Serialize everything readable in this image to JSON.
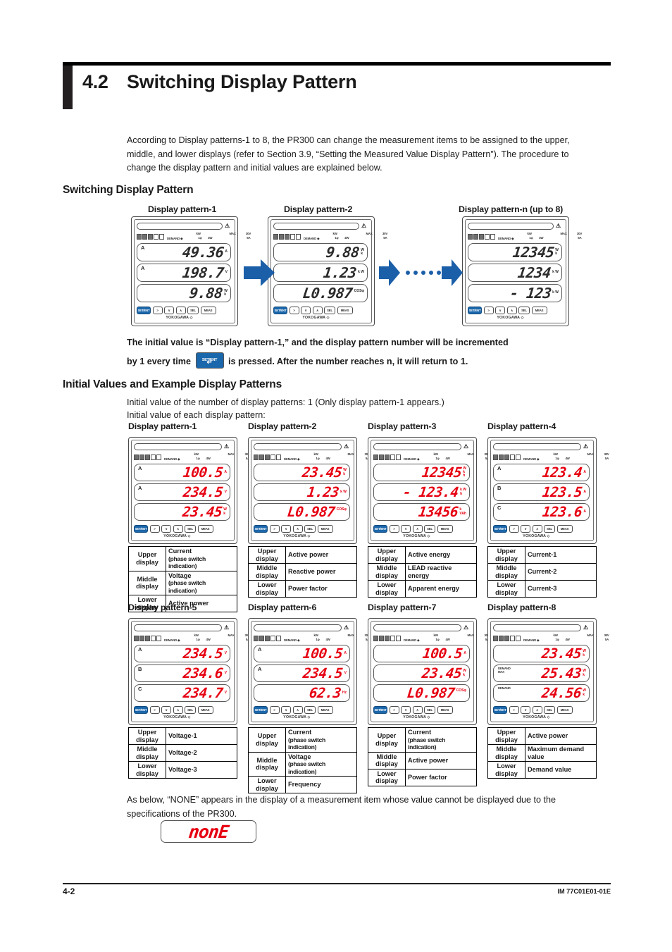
{
  "section": {
    "number": "4.2",
    "title": "Switching Display Pattern",
    "intro": "According to Display patterns-1 to 8, the PR300 can change the measurement items to be assigned to the upper, middle, and lower displays (refer to Section 3.9, “Setting the Measured Value Display Pattern”). The procedure to change the display pattern and initial values are explained below."
  },
  "switching": {
    "heading": "Switching Display Pattern",
    "labels": {
      "p1": "Display pattern-1",
      "p2": "Display pattern-2",
      "pn": "Display pattern-n (up to 8)"
    },
    "note_part1": "The initial value is “Display pattern-1,” and the display pattern number will be incremented",
    "note_part2": "by 1 every time",
    "note_part3": "is pressed. After the number reaches n, it will return to 1.",
    "setent_key": "SET/ENT"
  },
  "initial": {
    "heading": "Initial Values and Example Display Patterns",
    "line1": "Initial value of the number of display patterns: 1  (Only display pattern-1 appears.)",
    "line2": "Initial value of each display pattern:"
  },
  "meter": {
    "brand": "PR300",
    "logo": "YOKOGAWA ◇",
    "warn_icon": "warning-triangle-icon",
    "top_labels": [
      "kW",
      "1φ",
      "4W",
      "MAX",
      "30V",
      "5A"
    ],
    "buttons": [
      "SET/ENT",
      ">",
      "∨",
      "∧",
      "SEL",
      "MEAS"
    ]
  },
  "flow_meters": [
    {
      "id": "flow-1",
      "rows": [
        {
          "phase": "A",
          "value": "49.36",
          "unit_top": "",
          "unit_mid": "A",
          "unit_bot": ""
        },
        {
          "phase": "A",
          "value": "198.7",
          "unit_top": "",
          "unit_mid": "V",
          "unit_bot": ""
        },
        {
          "phase": "",
          "value": "9.88",
          "unit_top": "W",
          "unit_mid": "k",
          "unit_bot": ""
        }
      ]
    },
    {
      "id": "flow-2",
      "rows": [
        {
          "phase": "",
          "value": "9.88",
          "unit_top": "W",
          "unit_mid": "k",
          "unit_bot": ""
        },
        {
          "phase": "",
          "value": "1.23",
          "unit_top": "",
          "unit_mid": "k W",
          "unit_bot": ""
        },
        {
          "phase": "",
          "value": "L0.987",
          "unit_top": "COSφ",
          "unit_mid": "",
          "unit_bot": ""
        }
      ]
    },
    {
      "id": "flow-n",
      "rows": [
        {
          "phase": "",
          "value": "12345",
          "unit_top": "W",
          "unit_mid": "k",
          "unit_bot": ""
        },
        {
          "phase": "",
          "value": "1234",
          "unit_top": "",
          "unit_mid": "k W",
          "unit_bot": ""
        },
        {
          "phase": "",
          "value": "- 123",
          "unit_top": "",
          "unit_mid": "k W",
          "unit_bot": ""
        }
      ]
    }
  ],
  "patterns": [
    {
      "label": "Display pattern-1",
      "rows": [
        {
          "phase": "A",
          "demand": "",
          "value": "100.5",
          "unit_top": "",
          "unit_mid": "A",
          "unit_bot": ""
        },
        {
          "phase": "A",
          "demand": "",
          "value": "234.5",
          "unit_top": "",
          "unit_mid": "V",
          "unit_bot": ""
        },
        {
          "phase": "",
          "demand": "",
          "value": "23.45",
          "unit_top": "W",
          "unit_mid": "k",
          "unit_bot": ""
        }
      ],
      "table": [
        {
          "key": "Upper display",
          "value": "Current",
          "sub": "(phase switch indication)"
        },
        {
          "key": "Middle display",
          "value": "Voltage",
          "sub": "(phase switch indication)"
        },
        {
          "key": "Lower display",
          "value": "Active power",
          "sub": ""
        }
      ]
    },
    {
      "label": "Display pattern-2",
      "rows": [
        {
          "phase": "",
          "demand": "",
          "value": "23.45",
          "unit_top": "W",
          "unit_mid": "k",
          "unit_bot": ""
        },
        {
          "phase": "",
          "demand": "",
          "value": "1.23",
          "unit_top": "",
          "unit_mid": "k W",
          "unit_bot": ""
        },
        {
          "phase": "",
          "demand": "",
          "value": "L0.987",
          "unit_top": "COSφ",
          "unit_mid": "",
          "unit_bot": ""
        }
      ],
      "table": [
        {
          "key": "Upper display",
          "value": "Active power",
          "sub": ""
        },
        {
          "key": "Middle display",
          "value": "Reactive power",
          "sub": ""
        },
        {
          "key": "Lower display",
          "value": "Power factor",
          "sub": ""
        }
      ]
    },
    {
      "label": "Display pattern-3",
      "rows": [
        {
          "phase": "",
          "demand": "",
          "value": "12345",
          "unit_top": "W",
          "unit_mid": "k",
          "unit_bot": "h"
        },
        {
          "phase": "",
          "demand": "",
          "value": "- 123.4",
          "unit_top": "",
          "unit_mid": "k W",
          "unit_bot": "h"
        },
        {
          "phase": "",
          "demand": "",
          "value": "13456",
          "unit_top": "",
          "unit_mid": "k",
          "unit_bot": "VAh"
        }
      ],
      "table": [
        {
          "key": "Upper display",
          "value": "Active energy",
          "sub": ""
        },
        {
          "key": "Middle display",
          "value": "LEAD reactive energy",
          "sub": ""
        },
        {
          "key": "Lower display",
          "value": "Apparent energy",
          "sub": ""
        }
      ]
    },
    {
      "label": "Display pattern-4",
      "rows": [
        {
          "phase": "A",
          "demand": "",
          "value": "123.4",
          "unit_top": "",
          "unit_mid": "A",
          "unit_bot": ""
        },
        {
          "phase": "B",
          "demand": "",
          "value": "123.5",
          "unit_top": "",
          "unit_mid": "A",
          "unit_bot": ""
        },
        {
          "phase": "C",
          "demand": "",
          "value": "123.6",
          "unit_top": "",
          "unit_mid": "A",
          "unit_bot": ""
        }
      ],
      "table": [
        {
          "key": "Upper display",
          "value": "Current-1",
          "sub": ""
        },
        {
          "key": "Middle display",
          "value": "Current-2",
          "sub": ""
        },
        {
          "key": "Lower display",
          "value": "Current-3",
          "sub": ""
        }
      ]
    },
    {
      "label": "Display pattern-5",
      "rows": [
        {
          "phase": "A",
          "demand": "",
          "value": "234.5",
          "unit_top": "",
          "unit_mid": "V",
          "unit_bot": ""
        },
        {
          "phase": "B",
          "demand": "",
          "value": "234.6",
          "unit_top": "",
          "unit_mid": "V",
          "unit_bot": ""
        },
        {
          "phase": "C",
          "demand": "",
          "value": "234.7",
          "unit_top": "",
          "unit_mid": "V",
          "unit_bot": ""
        }
      ],
      "table": [
        {
          "key": "Upper display",
          "value": "Voltage-1",
          "sub": ""
        },
        {
          "key": "Middle display",
          "value": "Voltage-2",
          "sub": ""
        },
        {
          "key": "Lower display",
          "value": "Voltage-3",
          "sub": ""
        }
      ]
    },
    {
      "label": "Display pattern-6",
      "rows": [
        {
          "phase": "A",
          "demand": "",
          "value": "100.5",
          "unit_top": "",
          "unit_mid": "A",
          "unit_bot": ""
        },
        {
          "phase": "A",
          "demand": "",
          "value": "234.5",
          "unit_top": "",
          "unit_mid": "V",
          "unit_bot": ""
        },
        {
          "phase": "",
          "demand": "",
          "value": "62.3",
          "unit_top": "",
          "unit_mid": "Hz",
          "unit_bot": ""
        }
      ],
      "table": [
        {
          "key": "Upper display",
          "value": "Current",
          "sub": "(phase switch indication)"
        },
        {
          "key": "Middle display",
          "value": "Voltage",
          "sub": "(phase switch indication)"
        },
        {
          "key": "Lower display",
          "value": "Frequency",
          "sub": ""
        }
      ]
    },
    {
      "label": "Display pattern-7",
      "rows": [
        {
          "phase": "",
          "demand": "",
          "value": "100.5",
          "unit_top": "",
          "unit_mid": "A",
          "unit_bot": ""
        },
        {
          "phase": "",
          "demand": "",
          "value": "23.45",
          "unit_top": "W",
          "unit_mid": "k",
          "unit_bot": ""
        },
        {
          "phase": "",
          "demand": "",
          "value": "L0.987",
          "unit_top": "COSφ",
          "unit_mid": "",
          "unit_bot": ""
        }
      ],
      "table": [
        {
          "key": "Upper display",
          "value": "Current",
          "sub": "(phase switch indication)"
        },
        {
          "key": "Middle display",
          "value": "Active power",
          "sub": ""
        },
        {
          "key": "Lower display",
          "value": "Power factor",
          "sub": ""
        }
      ]
    },
    {
      "label": "Display pattern-8",
      "rows": [
        {
          "phase": "",
          "demand": "",
          "value": "23.45",
          "unit_top": "W",
          "unit_mid": "k",
          "unit_bot": ""
        },
        {
          "phase": "",
          "demand": "DEMAND\nMAX",
          "value": "25.43",
          "unit_top": "W",
          "unit_mid": "k",
          "unit_bot": ""
        },
        {
          "phase": "",
          "demand": "DEMAND",
          "value": "24.56",
          "unit_top": "W",
          "unit_mid": "k",
          "unit_bot": ""
        }
      ],
      "table": [
        {
          "key": "Upper display",
          "value": "Active power",
          "sub": ""
        },
        {
          "key": "Middle display",
          "value": "Maximum demand value",
          "sub": ""
        },
        {
          "key": "Lower display",
          "value": "Demand value",
          "sub": ""
        }
      ]
    }
  ],
  "none_note": {
    "text": "As below, “NONE” appears in the display of a measurement item whose value cannot be displayed due to the specifications of the PR300.",
    "display_value": "nonE"
  },
  "footer": {
    "page": "4-2",
    "doc_id": "IM 77C01E01-01E"
  },
  "colors": {
    "segment_red": "#e60012",
    "arrow_blue": "#1b5fa8",
    "key_blue": "#1b67ab"
  }
}
